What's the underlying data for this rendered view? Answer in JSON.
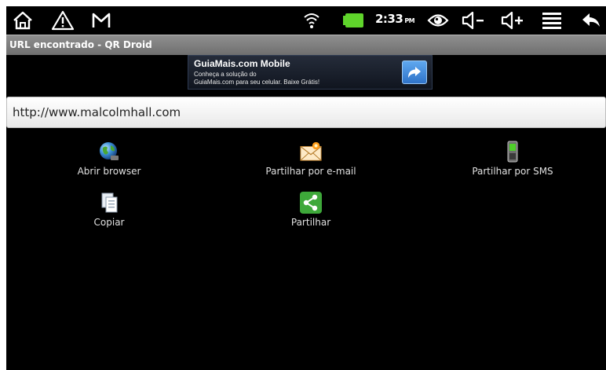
{
  "status_bar": {
    "icons_left": [
      "home-icon",
      "warning-icon",
      "gmail-icon"
    ],
    "icons_right": [
      "wifi-icon",
      "battery-icon",
      "eye-icon",
      "volume-down-icon",
      "volume-up-icon",
      "menu-icon",
      "back-icon"
    ],
    "time": "2:33",
    "ampm": "PM",
    "battery_color": "#5fd42b"
  },
  "title_bar": {
    "title": "URL encontrado - QR Droid"
  },
  "ad_banner": {
    "title": "GuiaMais.com Mobile",
    "line1": "Conheça a solução do",
    "line2": "GuiaMais.com para seu celular. Baixe Grátis!",
    "button_icon": "share-arrow-icon"
  },
  "url_field": {
    "value": "http://www.malcolmhall.com"
  },
  "actions": [
    {
      "label": "Abrir browser",
      "icon": "globe-icon"
    },
    {
      "label": "Partilhar por e-mail",
      "icon": "email-icon"
    },
    {
      "label": "Partilhar por SMS",
      "icon": "phone-icon"
    },
    {
      "label": "Copiar",
      "icon": "copy-icon"
    },
    {
      "label": "Partilhar",
      "icon": "share-icon"
    }
  ]
}
